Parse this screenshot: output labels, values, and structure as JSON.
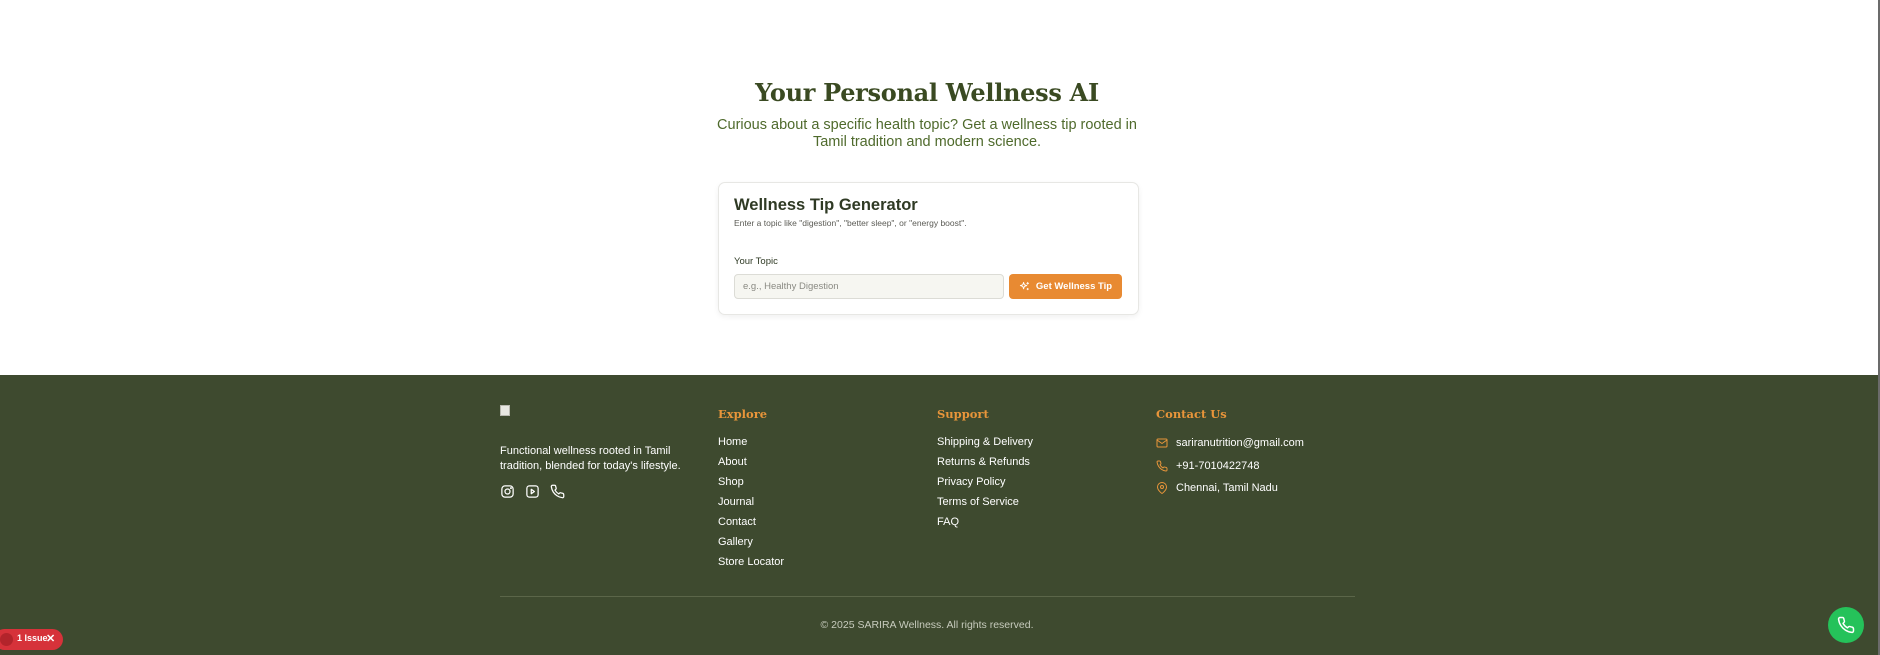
{
  "hero": {
    "title": "Your Personal Wellness AI",
    "subtitle": "Curious about a specific health topic? Get a wellness tip rooted in Tamil tradition and modern science."
  },
  "generator": {
    "title": "Wellness Tip Generator",
    "description": "Enter a topic like \"digestion\", \"better sleep\", or \"energy boost\".",
    "topic_label": "Your Topic",
    "topic_value": "",
    "topic_placeholder": "e.g., Healthy Digestion",
    "button_label": "Get Wellness Tip",
    "button_icon": "sparkles-icon"
  },
  "footer": {
    "tagline": "Functional wellness rooted in Tamil tradition, blended for today's lifestyle.",
    "social_icons": [
      "instagram-icon",
      "youtube-icon",
      "phone-icon"
    ],
    "explore": {
      "title": "Explore",
      "items": [
        "Home",
        "About",
        "Shop",
        "Journal",
        "Contact",
        "Gallery",
        "Store Locator"
      ]
    },
    "support": {
      "title": "Support",
      "items": [
        "Shipping & Delivery",
        "Returns & Refunds",
        "Privacy Policy",
        "Terms of Service",
        "FAQ"
      ]
    },
    "contact": {
      "title": "Contact Us",
      "email": "sariranutrition@gmail.com",
      "phone": "+91-7010422748",
      "location": "Chennai, Tamil Nadu"
    },
    "copyright": "© 2025 SARIRA Wellness. All rights reserved."
  },
  "overlay": {
    "issue_badge": "1 Issue",
    "call_button_icon": "phone-icon"
  },
  "colors": {
    "accent_orange": "#e88a32",
    "footer_bg": "#3e4a2f",
    "heading_green": "#3a4a22",
    "subtitle_green": "#4f6a2c",
    "call_fab": "#25c25a",
    "issue_red": "#d6323a"
  }
}
